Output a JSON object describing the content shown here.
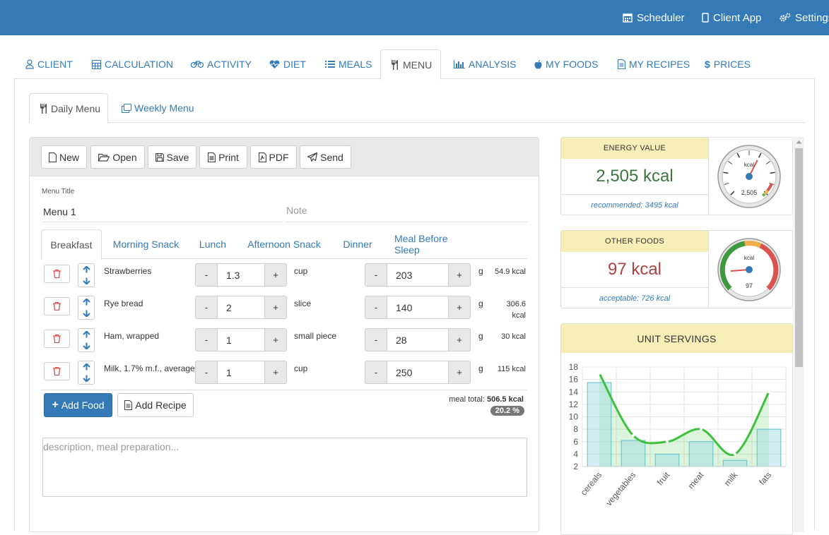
{
  "topnav": {
    "scheduler": "Scheduler",
    "client_app": "Client App",
    "settings": "Settings"
  },
  "main_tabs": [
    {
      "label": "CLIENT",
      "icon": "user-icon"
    },
    {
      "label": "CALCULATION",
      "icon": "calculator-icon"
    },
    {
      "label": "ACTIVITY",
      "icon": "bicycle-icon"
    },
    {
      "label": "DIET",
      "icon": "heartbeat-icon"
    },
    {
      "label": "MEALS",
      "icon": "list-icon"
    },
    {
      "label": "MENU",
      "icon": "cutlery-icon"
    },
    {
      "label": "ANALYSIS",
      "icon": "bar-chart-icon"
    },
    {
      "label": "MY FOODS",
      "icon": "apple-icon"
    },
    {
      "label": "MY RECIPES",
      "icon": "file-icon"
    },
    {
      "label": "PRICES",
      "icon": "dollar-icon"
    }
  ],
  "sub_tabs": [
    {
      "label": "Daily Menu"
    },
    {
      "label": "Weekly Menu"
    }
  ],
  "toolbar": {
    "new": "New",
    "open": "Open",
    "save": "Save",
    "print": "Print",
    "pdf": "PDF",
    "send": "Send"
  },
  "menu": {
    "title_label": "Menu Title",
    "title_value": "Menu 1",
    "note_placeholder": "Note"
  },
  "meal_tabs": [
    "Breakfast",
    "Morning Snack",
    "Lunch",
    "Afternoon Snack",
    "Dinner",
    "Meal Before Sleep"
  ],
  "foods": [
    {
      "name": "Strawberries",
      "qty": "1.3",
      "unit": "cup",
      "grams": "203",
      "g": "g",
      "kcal": "54.9 kcal"
    },
    {
      "name": "Rye bread",
      "qty": "2",
      "unit": "slice",
      "grams": "140",
      "g": "g",
      "kcal": "306.6 kcal"
    },
    {
      "name": "Ham, wrapped",
      "qty": "1",
      "unit": "small piece",
      "grams": "28",
      "g": "g",
      "kcal": "30 kcal"
    },
    {
      "name": "Milk, 1.7% m.f., average",
      "qty": "1",
      "unit": "cup",
      "grams": "250",
      "g": "g",
      "kcal": "115 kcal"
    }
  ],
  "stepper": {
    "minus": "-",
    "plus": "+"
  },
  "actions": {
    "add_food": "Add Food",
    "add_recipe": "Add Recipe"
  },
  "meal_total": {
    "label": "meal total:",
    "value": "506.5 kcal",
    "percent": "20.2 %"
  },
  "description_placeholder": "description, meal preparation...",
  "energy": {
    "header": "ENERGY VALUE",
    "value": "2,505 kcal",
    "recommended": "recommended: 3495 kcal",
    "gauge_unit": "kcal",
    "gauge_value": "2,505",
    "gauge_fraction": 0.6
  },
  "other_foods": {
    "header": "OTHER FOODS",
    "value": "97 kcal",
    "acceptable": "acceptable: 726 kcal",
    "gauge_unit": "kcal",
    "gauge_value": "97",
    "gauge_fraction": 0.15
  },
  "unit_servings": {
    "header": "UNIT SERVINGS"
  },
  "colors": {
    "brand": "#337ab7",
    "energy_value": "#3c763d",
    "other_value": "#a94442",
    "header_bg": "#f7edb7"
  },
  "chart_data": {
    "type": "bar",
    "categories": [
      "cereals",
      "vegetables",
      "fruit",
      "meat",
      "milk",
      "fats"
    ],
    "series": [
      {
        "type": "bar",
        "values": [
          15.5,
          6.2,
          4,
          6,
          3,
          8
        ]
      },
      {
        "type": "line",
        "values": [
          17,
          7,
          6,
          8,
          4,
          14
        ]
      }
    ],
    "ylim": [
      2,
      18
    ],
    "yticks": [
      2,
      4,
      6,
      8,
      10,
      12,
      14,
      16,
      18
    ],
    "grid": true
  }
}
